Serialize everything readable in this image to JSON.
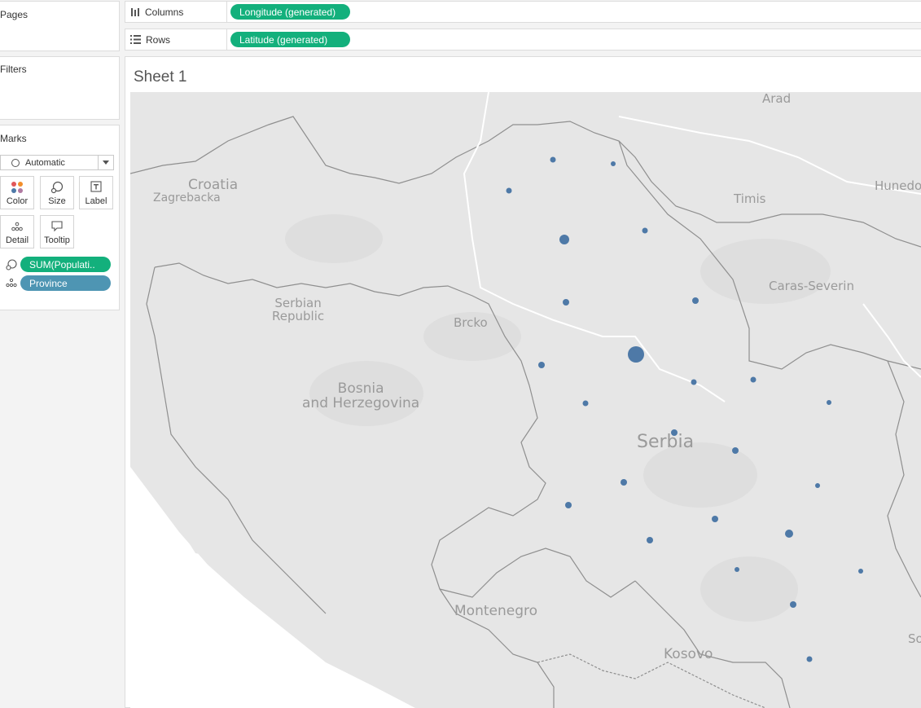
{
  "left_panel": {
    "pages_title": "Pages",
    "filters_title": "Filters",
    "marks_title": "Marks",
    "mark_type": "Automatic",
    "mark_buttons": {
      "color": "Color",
      "size": "Size",
      "label": "Label",
      "detail": "Detail",
      "tooltip": "Tooltip"
    },
    "mark_fields": {
      "size_field": "SUM(Populati..",
      "detail_field": "Province"
    }
  },
  "shelves": {
    "columns_label": "Columns",
    "columns_pill": "Longitude (generated)",
    "rows_label": "Rows",
    "rows_pill": "Latitude (generated)"
  },
  "sheet": {
    "title": "Sheet 1"
  },
  "map": {
    "labels": {
      "arad": "Arad",
      "croatia": "Croatia",
      "zagrebacka": "Zagrebacka",
      "timis": "Timis",
      "hunedoara": "Hunedo",
      "caras_severin": "Caras-Severin",
      "serbian_republic_line1": "Serbian",
      "serbian_republic_line2": "Republic",
      "brcko": "Brcko",
      "bosnia_line1": "Bosnia",
      "bosnia_line2": "and Herzegovina",
      "serbia": "Serbia",
      "montenegro": "Montenegro",
      "kosovo": "Kosovo",
      "sofia_partial": "So"
    },
    "colors": {
      "land": "#e6e6e6",
      "sea": "#ffffff",
      "border": "#8f8f8f",
      "mark": "#4e79a7"
    },
    "note": ""
  }
}
